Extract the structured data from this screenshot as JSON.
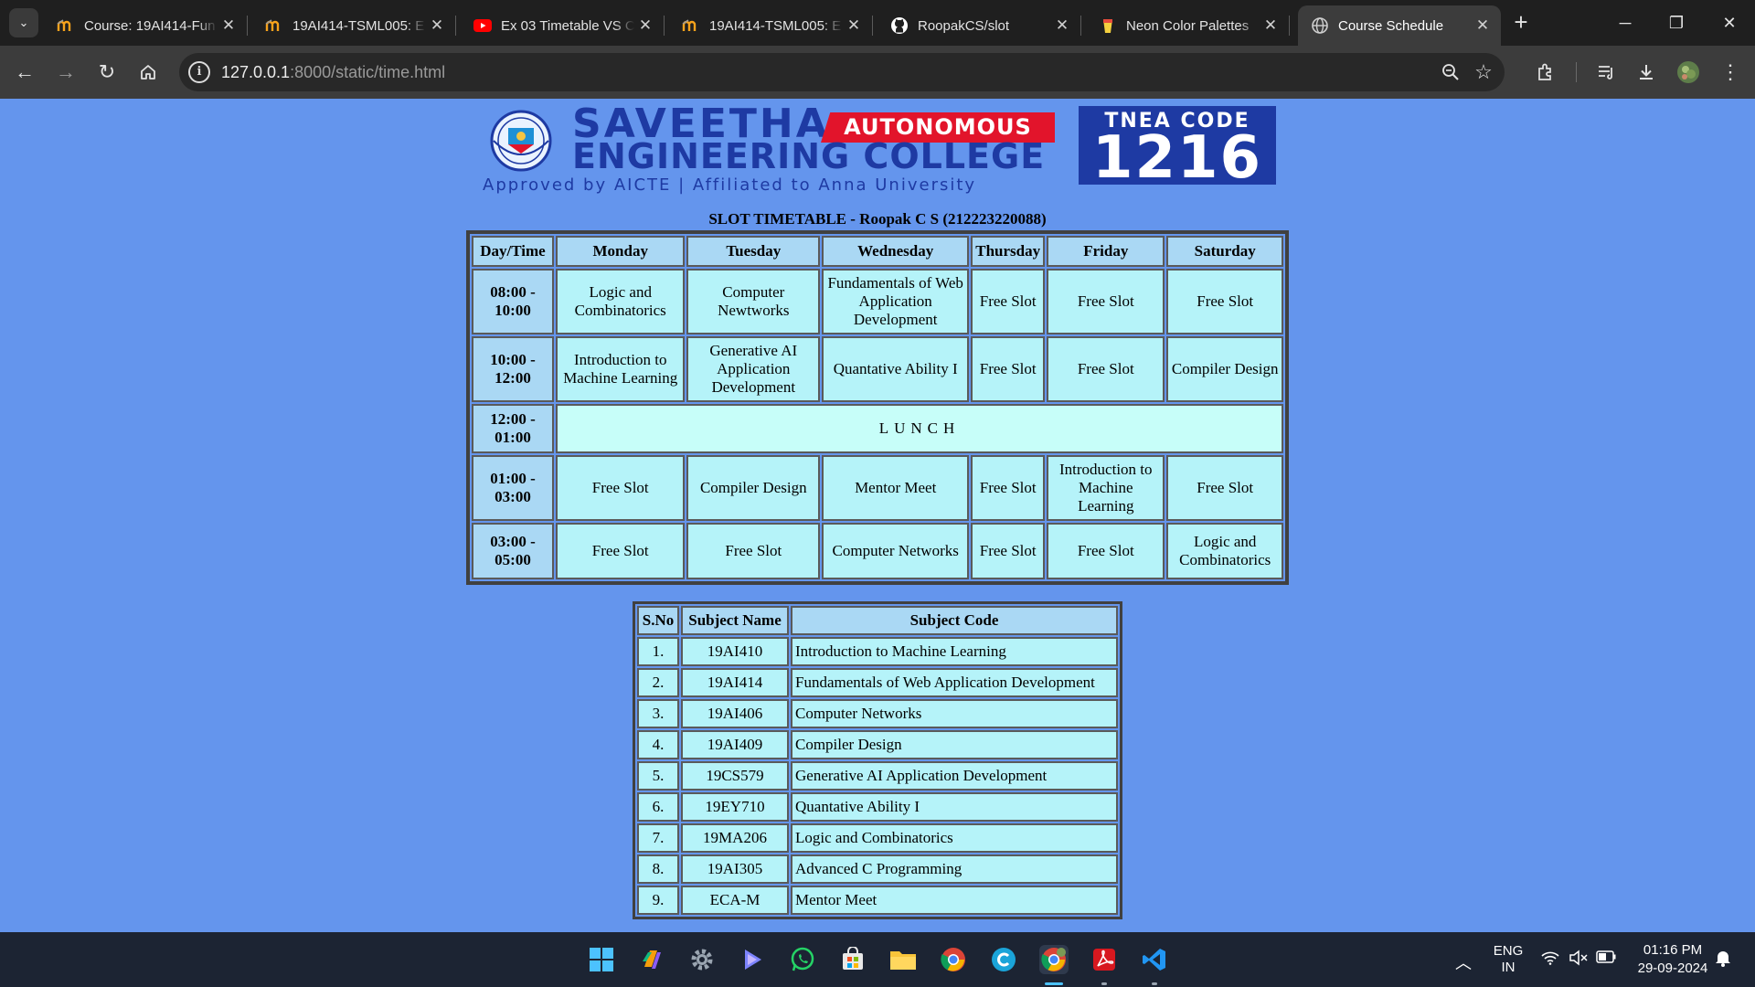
{
  "browser": {
    "tabs": [
      {
        "title": "Course: 19AI414-Fun",
        "icon": "moodle-icon",
        "active": false
      },
      {
        "title": "19AI414-TSML005: E",
        "icon": "moodle-icon",
        "active": false
      },
      {
        "title": "Ex 03 Timetable VS C",
        "icon": "youtube-icon",
        "active": false
      },
      {
        "title": "19AI414-TSML005: E",
        "icon": "moodle-icon",
        "active": false
      },
      {
        "title": "RoopakCS/slot",
        "icon": "github-icon",
        "active": false
      },
      {
        "title": "Neon Color Palettes",
        "icon": "palette-icon",
        "active": false
      },
      {
        "title": "Course Schedule",
        "icon": "globe-icon",
        "active": true
      }
    ],
    "url_host": "127.0.0.1",
    "url_path": ":8000/static/time.html"
  },
  "header": {
    "college_line1": "SAVEETHA",
    "autonomous": "AUTONOMOUS",
    "college_line2": "ENGINEERING COLLEGE",
    "tagline": "Approved by AICTE  |  Affiliated to Anna University",
    "tnea_label": "TNEA CODE",
    "tnea_code": "1216"
  },
  "timetable": {
    "caption": "SLOT TIMETABLE - Roopak C S (212223220088)",
    "headers": [
      "Day/Time",
      "Monday",
      "Tuesday",
      "Wednesday",
      "Thursday",
      "Friday",
      "Saturday"
    ],
    "rows": [
      {
        "time": "08:00 - 10:00",
        "cells": [
          "Logic and Combinatorics",
          "Computer Newtworks",
          "Fundamentals of Web Application Development",
          "Free Slot",
          "Free Slot",
          "Free Slot"
        ]
      },
      {
        "time": "10:00 - 12:00",
        "cells": [
          "Introduction to Machine Learning",
          "Generative AI Application Development",
          "Quantative Ability I",
          "Free Slot",
          "Free Slot",
          "Compiler Design"
        ]
      },
      {
        "time": "12:00 - 01:00",
        "lunch": "LUNCH"
      },
      {
        "time": "01:00 - 03:00",
        "cells": [
          "Free Slot",
          "Compiler Design",
          "Mentor Meet",
          "Free Slot",
          "Introduction to Machine Learning",
          "Free Slot"
        ]
      },
      {
        "time": "03:00 - 05:00",
        "cells": [
          "Free Slot",
          "Free Slot",
          "Computer Networks",
          "Free Slot",
          "Free Slot",
          "Logic and Combinatorics"
        ]
      }
    ]
  },
  "subjects": {
    "headers": [
      "S.No",
      "Subject Name",
      "Subject Code"
    ],
    "rows": [
      {
        "sno": "1.",
        "code": "19AI410",
        "name": "Introduction to Machine Learning"
      },
      {
        "sno": "2.",
        "code": "19AI414",
        "name": "Fundamentals of Web Application Development"
      },
      {
        "sno": "3.",
        "code": "19AI406",
        "name": "Computer Networks"
      },
      {
        "sno": "4.",
        "code": "19AI409",
        "name": "Compiler Design"
      },
      {
        "sno": "5.",
        "code": "19CS579",
        "name": "Generative AI Application Development"
      },
      {
        "sno": "6.",
        "code": "19EY710",
        "name": "Quantative Ability I"
      },
      {
        "sno": "7.",
        "code": "19MA206",
        "name": "Logic and Combinatorics"
      },
      {
        "sno": "8.",
        "code": "19AI305",
        "name": "Advanced C Programming"
      },
      {
        "sno": "9.",
        "code": "ECA-M",
        "name": "Mentor Meet"
      }
    ]
  },
  "taskbar": {
    "lang": "ENG",
    "region": "IN",
    "time": "01:16 PM",
    "date": "29-09-2024"
  },
  "colors": {
    "page_bg": "#6495ed",
    "header_cell": "#aad8f4",
    "body_cell": "#b5f3f9",
    "lunch_cell": "#c7fef9",
    "college_blue": "#1e3aa3",
    "autonomous_red": "#e2142b"
  }
}
